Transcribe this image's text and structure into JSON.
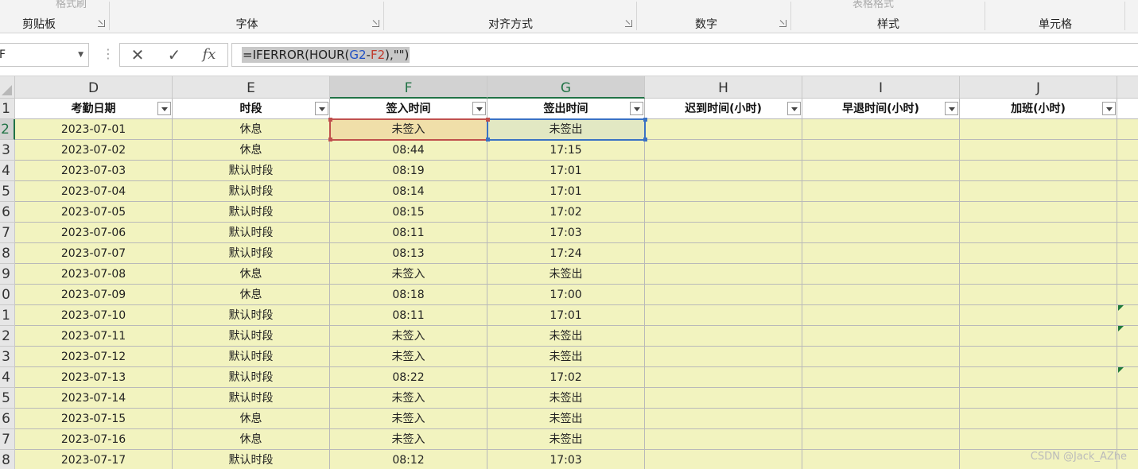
{
  "ribbon": {
    "groups": [
      {
        "label": "剪贴板"
      },
      {
        "label": "字体"
      },
      {
        "label": "对齐方式"
      },
      {
        "label": "数字"
      },
      {
        "label": "样式"
      },
      {
        "label": "单元格"
      }
    ],
    "ghost_format_painter": "格式刷",
    "ghost_table_format": "表格格式"
  },
  "formula_bar": {
    "name_box": "F",
    "cancel_icon": "✕",
    "enter_icon": "✓",
    "fx_label": "fx",
    "formula_parts": [
      {
        "text": "=IFERROR(HOUR(",
        "color": "#222222"
      },
      {
        "text": "G2",
        "color": "#1f4fc4"
      },
      {
        "text": "-",
        "color": "#222222"
      },
      {
        "text": "F2",
        "color": "#c0392b"
      },
      {
        "text": "),\"\")",
        "color": "#222222"
      }
    ]
  },
  "sheet": {
    "columns": [
      "D",
      "E",
      "F",
      "G",
      "H",
      "I",
      "J"
    ],
    "selected_columns": [
      "F",
      "G"
    ],
    "row_numbers": [
      "1",
      "2",
      "3",
      "4",
      "5",
      "6",
      "7",
      "8",
      "9",
      "0",
      "1",
      "2",
      "3",
      "4",
      "5",
      "6",
      "7",
      "8"
    ],
    "selected_row": 2,
    "headers": [
      "考勤日期",
      "时段",
      "签入时间",
      "签出时间",
      "迟到时间(小时)",
      "早退时间(小时)",
      "加班(小时)"
    ],
    "rows": [
      [
        "2023-07-01",
        "休息",
        "未签入",
        "未签出",
        "",
        "",
        ""
      ],
      [
        "2023-07-02",
        "休息",
        "08:44",
        "17:15",
        "",
        "",
        ""
      ],
      [
        "2023-07-03",
        "默认时段",
        "08:19",
        "17:01",
        "",
        "",
        ""
      ],
      [
        "2023-07-04",
        "默认时段",
        "08:14",
        "17:01",
        "",
        "",
        ""
      ],
      [
        "2023-07-05",
        "默认时段",
        "08:15",
        "17:02",
        "",
        "",
        ""
      ],
      [
        "2023-07-06",
        "默认时段",
        "08:11",
        "17:03",
        "",
        "",
        ""
      ],
      [
        "2023-07-07",
        "默认时段",
        "08:13",
        "17:24",
        "",
        "",
        ""
      ],
      [
        "2023-07-08",
        "休息",
        "未签入",
        "未签出",
        "",
        "",
        ""
      ],
      [
        "2023-07-09",
        "休息",
        "08:18",
        "17:00",
        "",
        "",
        ""
      ],
      [
        "2023-07-10",
        "默认时段",
        "08:11",
        "17:01",
        "",
        "",
        ""
      ],
      [
        "2023-07-11",
        "默认时段",
        "未签入",
        "未签出",
        "",
        "",
        ""
      ],
      [
        "2023-07-12",
        "默认时段",
        "未签入",
        "未签出",
        "",
        "",
        ""
      ],
      [
        "2023-07-13",
        "默认时段",
        "08:22",
        "17:02",
        "",
        "",
        ""
      ],
      [
        "2023-07-14",
        "默认时段",
        "未签入",
        "未签出",
        "",
        "",
        ""
      ],
      [
        "2023-07-15",
        "休息",
        "未签入",
        "未签出",
        "",
        "",
        ""
      ],
      [
        "2023-07-16",
        "休息",
        "未签入",
        "未签出",
        "",
        "",
        ""
      ],
      [
        "2023-07-17",
        "默认时段",
        "08:12",
        "17:03",
        "",
        "",
        ""
      ]
    ]
  },
  "watermark": "CSDN @Jack_AZhe"
}
